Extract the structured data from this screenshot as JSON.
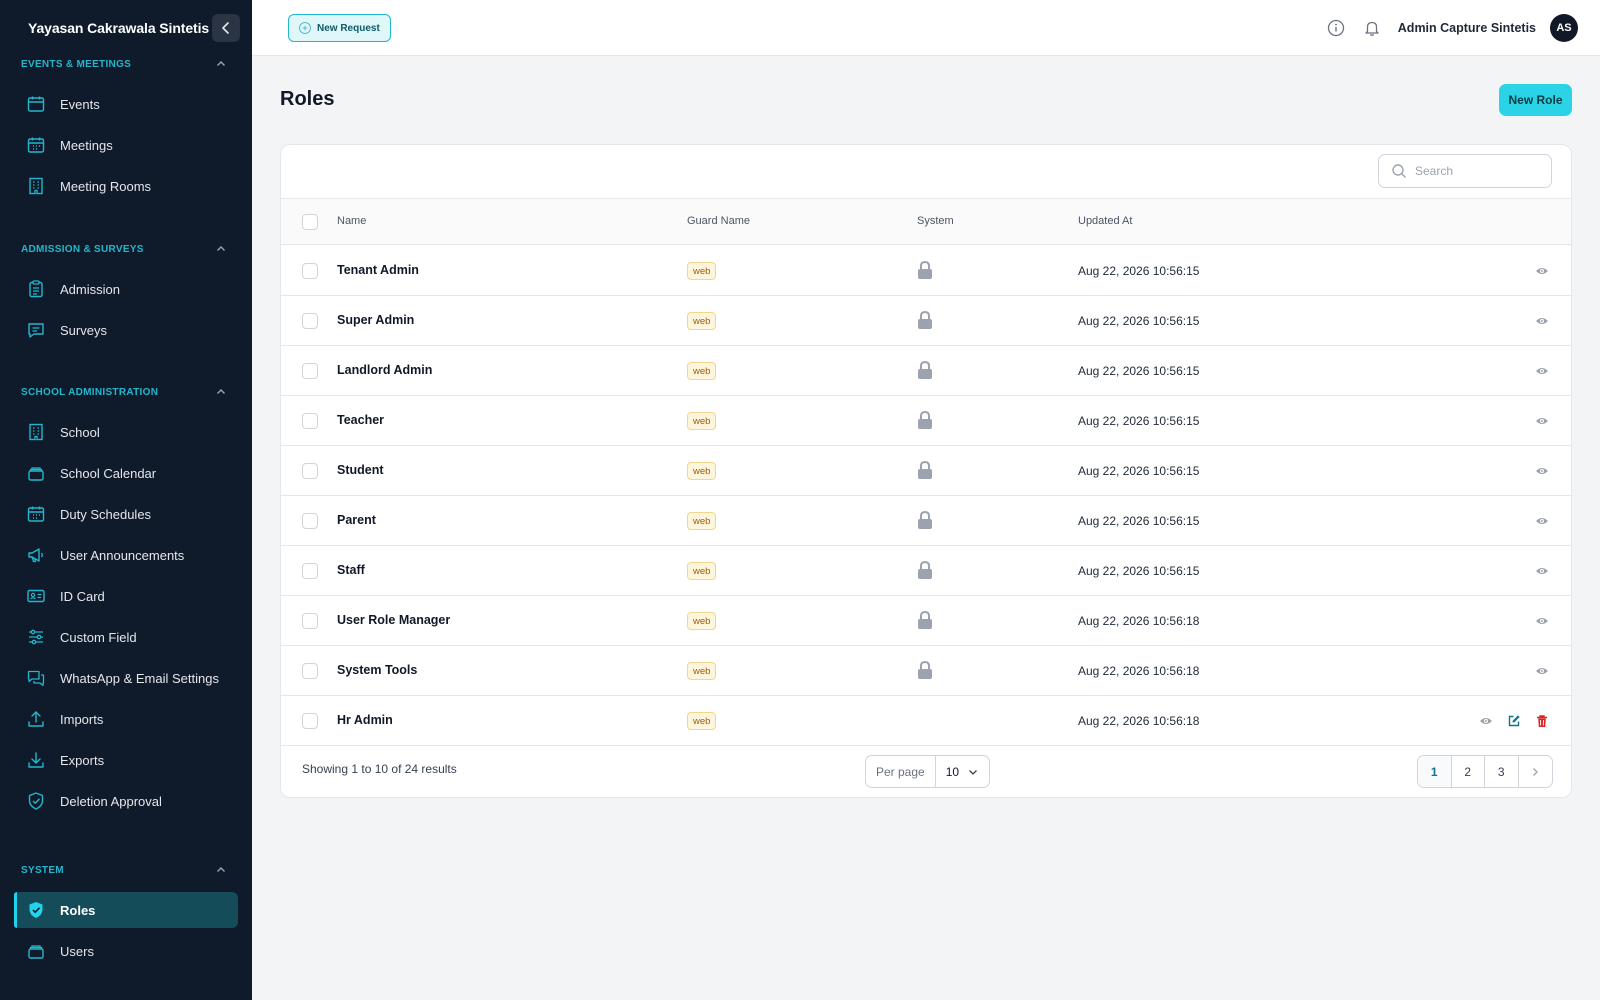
{
  "sidebar": {
    "brand": "Yayasan Cakrawala Sintetis",
    "groups": [
      {
        "label": "EVENTS & MEETINGS",
        "items": [
          {
            "label": "Events",
            "icon": "calendar-icon"
          },
          {
            "label": "Meetings",
            "icon": "calendar-grid-icon"
          },
          {
            "label": "Meeting Rooms",
            "icon": "building-icon"
          }
        ]
      },
      {
        "label": "ADMISSION & SURVEYS",
        "items": [
          {
            "label": "Admission",
            "icon": "clipboard-icon"
          },
          {
            "label": "Surveys",
            "icon": "chat-icon"
          }
        ]
      },
      {
        "label": "SCHOOL ADMINISTRATION",
        "items": [
          {
            "label": "School",
            "icon": "building-icon"
          },
          {
            "label": "School Calendar",
            "icon": "stack-icon"
          },
          {
            "label": "Duty Schedules",
            "icon": "calendar-grid-icon"
          },
          {
            "label": "User Announcements",
            "icon": "megaphone-icon"
          },
          {
            "label": "ID Card",
            "icon": "id-card-icon"
          },
          {
            "label": "Custom Field",
            "icon": "sliders-icon"
          },
          {
            "label": "WhatsApp & Email Settings",
            "icon": "chat-bubbles-icon"
          },
          {
            "label": "Imports",
            "icon": "upload-icon"
          },
          {
            "label": "Exports",
            "icon": "download-icon"
          },
          {
            "label": "Deletion Approval",
            "icon": "shield-check-icon"
          }
        ]
      },
      {
        "label": "SYSTEM",
        "items": [
          {
            "label": "Roles",
            "icon": "shield-check-icon",
            "active": true
          },
          {
            "label": "Users",
            "icon": "stack-icon"
          }
        ]
      }
    ]
  },
  "topbar": {
    "new_request": "New Request",
    "user_name": "Admin Capture Sintetis",
    "avatar_initials": "AS"
  },
  "main": {
    "title": "Roles",
    "new_role": "New Role",
    "search_placeholder": "Search",
    "columns": [
      "Name",
      "Guard Name",
      "System",
      "Updated At"
    ],
    "rows": [
      {
        "name": "Tenant Admin",
        "guard": "web",
        "system": true,
        "updated": "Aug 22, 2026 10:56:15"
      },
      {
        "name": "Super Admin",
        "guard": "web",
        "system": true,
        "updated": "Aug 22, 2026 10:56:15"
      },
      {
        "name": "Landlord Admin",
        "guard": "web",
        "system": true,
        "updated": "Aug 22, 2026 10:56:15"
      },
      {
        "name": "Teacher",
        "guard": "web",
        "system": true,
        "updated": "Aug 22, 2026 10:56:15"
      },
      {
        "name": "Student",
        "guard": "web",
        "system": true,
        "updated": "Aug 22, 2026 10:56:15"
      },
      {
        "name": "Parent",
        "guard": "web",
        "system": true,
        "updated": "Aug 22, 2026 10:56:15"
      },
      {
        "name": "Staff",
        "guard": "web",
        "system": true,
        "updated": "Aug 22, 2026 10:56:15"
      },
      {
        "name": "User Role Manager",
        "guard": "web",
        "system": true,
        "updated": "Aug 22, 2026 10:56:18"
      },
      {
        "name": "System Tools",
        "guard": "web",
        "system": true,
        "updated": "Aug 22, 2026 10:56:18"
      },
      {
        "name": "Hr Admin",
        "guard": "web",
        "system": false,
        "updated": "Aug 22, 2026 10:56:18"
      }
    ],
    "footer": {
      "showing": "Showing 1 to 10 of 24 results",
      "per_page_label": "Per page",
      "per_page_value": "10",
      "pages": [
        "1",
        "2",
        "3"
      ],
      "current_page": "1"
    }
  },
  "colors": {
    "sidebar_bg": "#0f1a2b",
    "accent": "#22d3ee",
    "group_label": "#22b7cc",
    "delete": "#dc2626",
    "edit": "#0e7490"
  }
}
